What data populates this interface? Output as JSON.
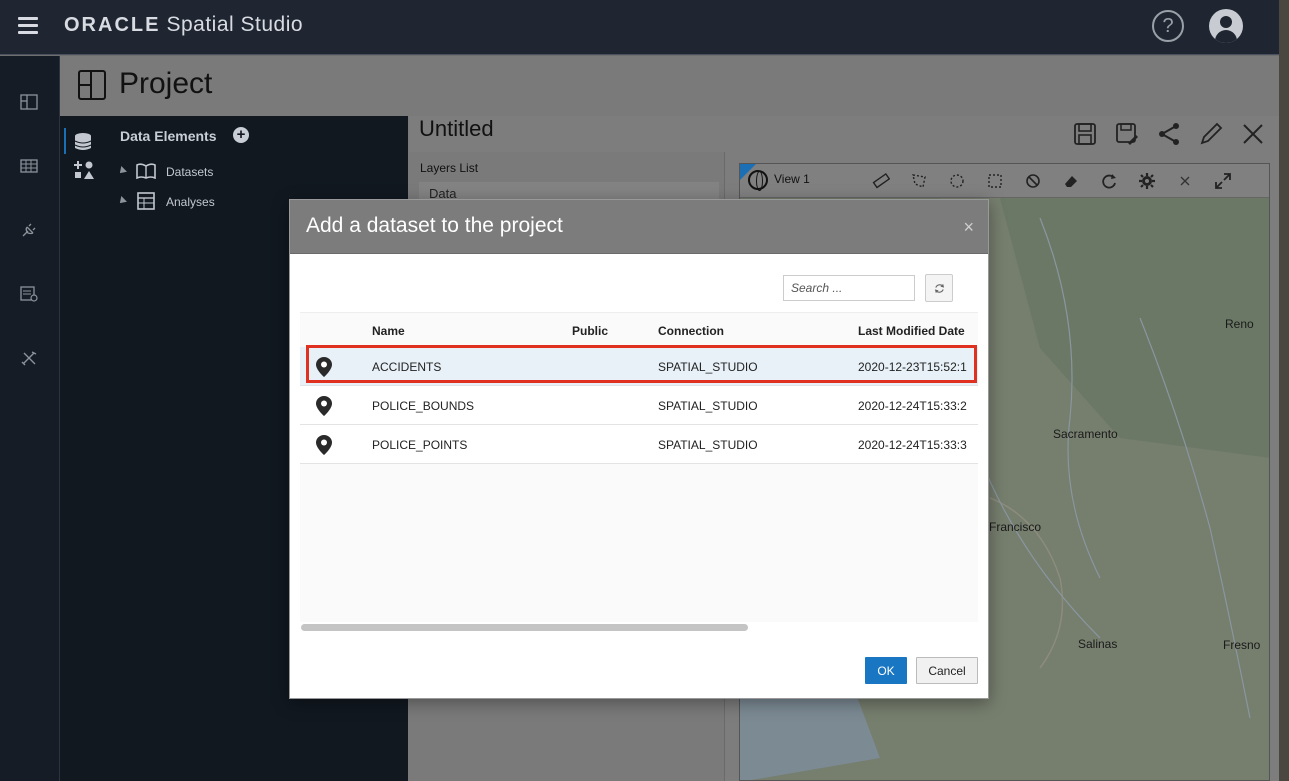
{
  "app": {
    "brand_oracle": "ORACLE",
    "brand_product": "Spatial Studio",
    "help_glyph": "?"
  },
  "project": {
    "title": "Project"
  },
  "data_panel": {
    "title": "Data Elements",
    "add_glyph": "+",
    "tree": [
      {
        "label": "Datasets"
      },
      {
        "label": "Analyses"
      }
    ]
  },
  "canvas": {
    "title": "Untitled",
    "layers_label": "Layers List",
    "layers_first": "Data",
    "map_tab": "View 1",
    "cities": [
      "Reno",
      "Sacramento",
      "Francisco",
      "Salinas",
      "Fresno"
    ]
  },
  "modal": {
    "title": "Add a dataset to the project",
    "close_glyph": "×",
    "search_placeholder": "Search ...",
    "columns": {
      "name": "Name",
      "public": "Public",
      "connection": "Connection",
      "modified": "Last Modified Date"
    },
    "rows": [
      {
        "name": "ACCIDENTS",
        "public": "",
        "connection": "SPATIAL_STUDIO",
        "modified": "2020-12-23T15:52:1"
      },
      {
        "name": "POLICE_BOUNDS",
        "public": "",
        "connection": "SPATIAL_STUDIO",
        "modified": "2020-12-24T15:33:2"
      },
      {
        "name": "POLICE_POINTS",
        "public": "",
        "connection": "SPATIAL_STUDIO",
        "modified": "2020-12-24T15:33:3"
      }
    ],
    "ok_label": "OK",
    "cancel_label": "Cancel"
  },
  "colors": {
    "topbar": "#1f2631",
    "accent": "#1976c2",
    "highlight": "#e03020"
  }
}
